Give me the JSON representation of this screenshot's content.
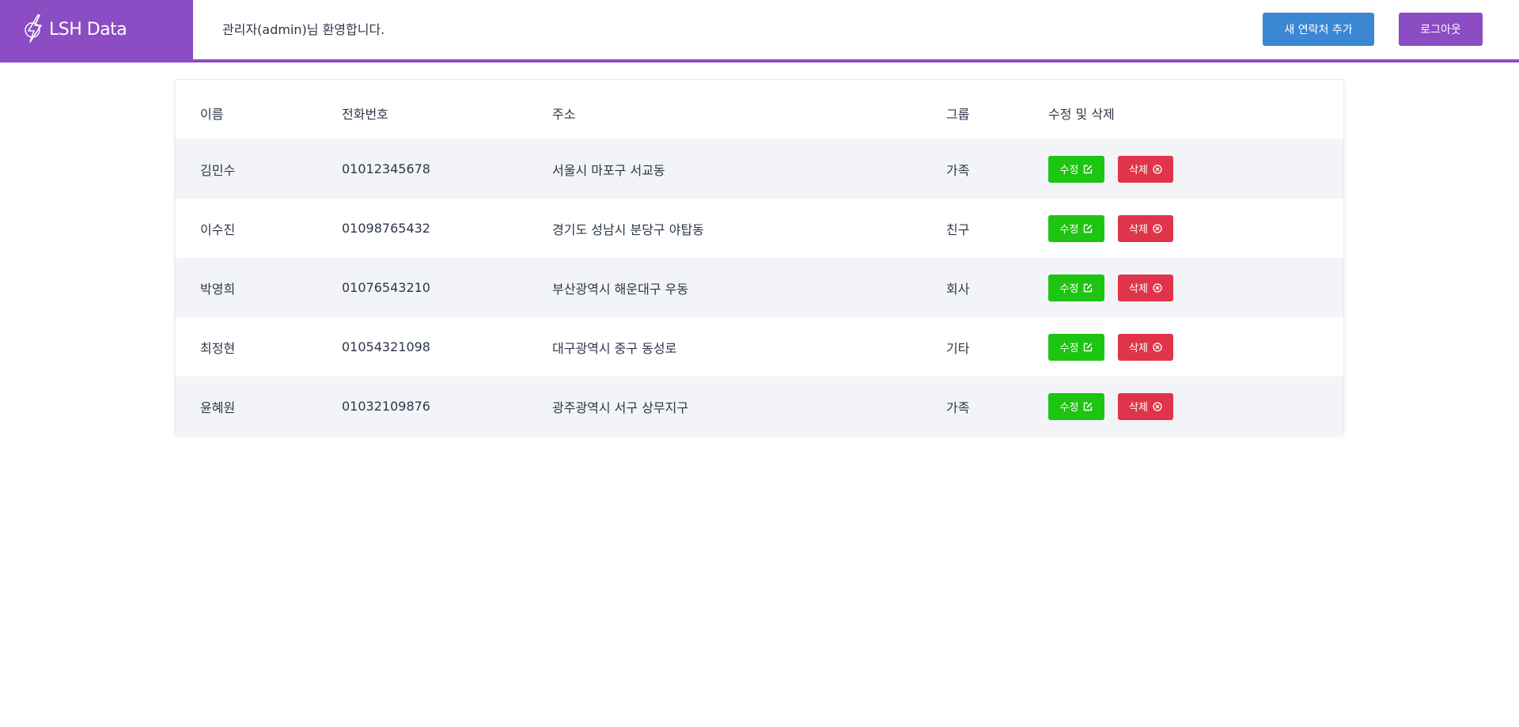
{
  "header": {
    "logo_text": "LSH Data",
    "welcome": "관리자(admin)님 환영합니다.",
    "add_contact_label": "새 연락처 추가",
    "logout_label": "로그아웃"
  },
  "table": {
    "columns": [
      "이름",
      "전화번호",
      "주소",
      "그룹",
      "수정 및 삭제"
    ],
    "edit_label": "수정",
    "delete_label": "삭제",
    "rows": [
      {
        "name": "김민수",
        "phone": "01012345678",
        "address": "서울시 마포구 서교동",
        "group": "가족"
      },
      {
        "name": "이수진",
        "phone": "01098765432",
        "address": "경기도 성남시 분당구 야탑동",
        "group": "친구"
      },
      {
        "name": "박영희",
        "phone": "01076543210",
        "address": "부산광역시 해운대구 우동",
        "group": "회사"
      },
      {
        "name": "최정현",
        "phone": "01054321098",
        "address": "대구광역시 중구 동성로",
        "group": "기타"
      },
      {
        "name": "윤혜원",
        "phone": "01032109876",
        "address": "광주광역시 서구 상무지구",
        "group": "가족"
      }
    ]
  },
  "colors": {
    "brand": "#8b4cc4",
    "primary": "#3b87d4",
    "edit": "#1ec412",
    "delete": "#e0344a",
    "row_alt": "#f3f4f8"
  },
  "icons": {
    "logo": "lightning-logo-icon",
    "edit": "edit-square-icon",
    "delete": "circle-x-icon"
  }
}
